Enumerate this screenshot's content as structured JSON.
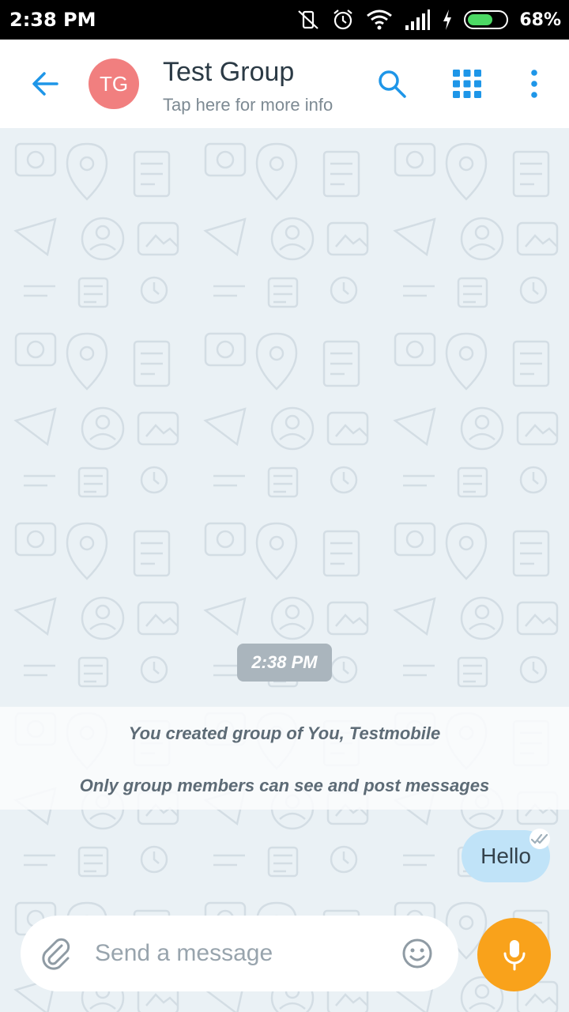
{
  "status_bar": {
    "time": "2:38 PM",
    "battery_percent": "68%",
    "battery_level": 0.68,
    "icons": [
      "vibrate-off-icon",
      "alarm-icon",
      "wifi-icon",
      "signal-icon",
      "charging-icon",
      "battery-icon"
    ]
  },
  "header": {
    "avatar_initials": "TG",
    "avatar_color": "#f17f7f",
    "title": "Test Group",
    "subtitle": "Tap here for more info",
    "icons": [
      "back-arrow-icon",
      "search-icon",
      "grid-apps-icon",
      "more-vert-icon"
    ],
    "accent_color": "#1e96e8"
  },
  "chat": {
    "date_chip": "2:38 PM",
    "system_messages": [
      "You created group of You, Testmobile",
      "Only group members can see and post messages"
    ],
    "messages": [
      {
        "text": "Hello",
        "outgoing": true,
        "status": "double-check-icon"
      }
    ]
  },
  "composer": {
    "placeholder": "Send a message",
    "value": "",
    "icons": [
      "attach-icon",
      "emoji-icon",
      "mic-icon"
    ],
    "mic_color": "#f9a21b"
  }
}
